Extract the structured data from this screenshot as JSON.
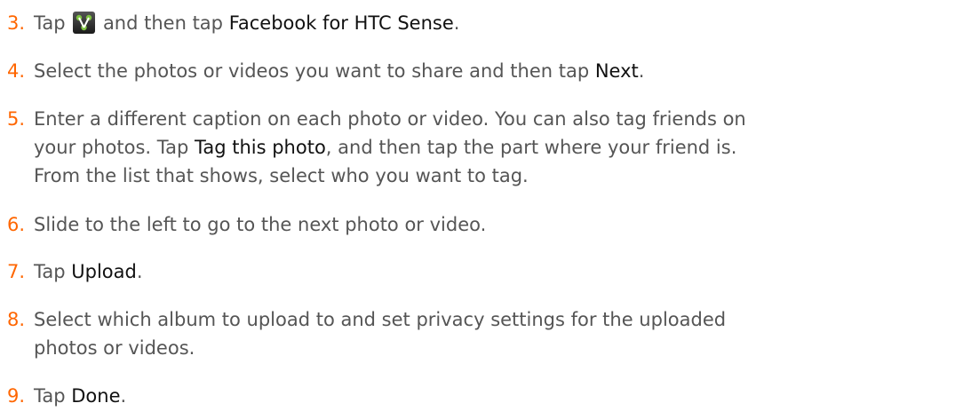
{
  "steps": [
    {
      "number": "3.",
      "before_icon": "Tap",
      "icon": "share-icon",
      "after_icon": "and then tap",
      "action": "Facebook for HTC Sense",
      "end": "."
    },
    {
      "number": "4.",
      "before": "Select the photos or videos you want to share and then tap",
      "action": "Next",
      "end": "."
    },
    {
      "number": "5.",
      "line1": "Enter a different caption on each photo or video. You can also tag friends on",
      "line2_before": "your photos. Tap",
      "action": "Tag this photo",
      "line2_after": ", and then tap the part where your friend is.",
      "line3": "From the list that shows, select who you want to tag."
    },
    {
      "number": "6.",
      "text": "Slide to the left to go to the next photo or video."
    },
    {
      "number": "7.",
      "before": "Tap",
      "action": "Upload",
      "end": "."
    },
    {
      "number": "8.",
      "line1": "Select which album to upload to and set privacy settings for the uploaded",
      "line2": "photos or videos."
    },
    {
      "number": "9.",
      "before": "Tap",
      "action": "Done",
      "end": "."
    }
  ],
  "colors": {
    "step_number": "#ff6600",
    "body_text": "#555555",
    "ui_term": "#111111"
  }
}
